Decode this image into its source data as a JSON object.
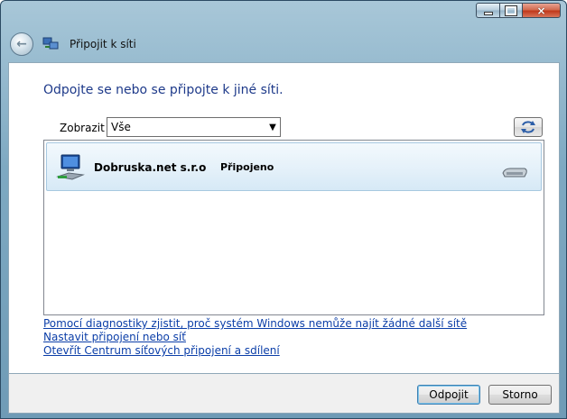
{
  "window": {
    "title": "Připojit k síti",
    "caption_buttons": {
      "close_glyph": "×"
    }
  },
  "header": {
    "heading": "Odpojte se nebo se připojte k jiné síti."
  },
  "filter": {
    "label": "Zobrazit",
    "selected": "Vše"
  },
  "networks": [
    {
      "name": "Dobruska.net s.r.o",
      "status": "Připojeno"
    }
  ],
  "links": [
    "Pomocí diagnostiky zjistit, proč systém Windows nemůže najít žádné další sítě",
    "Nastavit připojení nebo síť",
    "Otevřít Centrum síťových připojení a sdílení"
  ],
  "footer": {
    "connect_label": "Odpojit",
    "cancel_label": "Storno"
  },
  "colors": {
    "heading": "#1e3a8a",
    "link": "#0b3ea8",
    "row_highlight": "#e3f0f9"
  }
}
